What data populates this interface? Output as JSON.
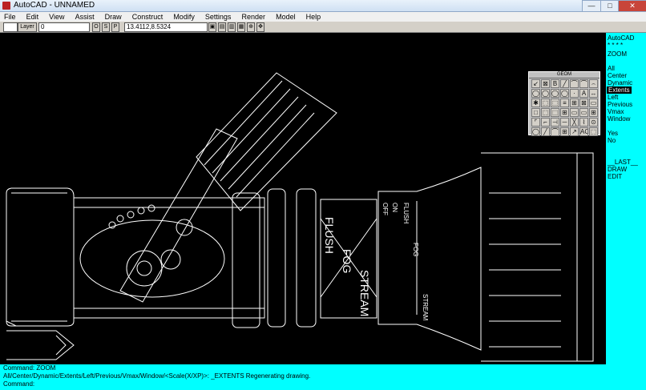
{
  "window": {
    "title": "AutoCAD - UNNAMED",
    "min": "—",
    "max": "□",
    "close": "✕"
  },
  "menu": [
    "File",
    "Edit",
    "View",
    "Assist",
    "Draw",
    "Construct",
    "Modify",
    "Settings",
    "Render",
    "Model",
    "Help"
  ],
  "toolbar": {
    "layer_label": "Layer",
    "layer_value": "0",
    "snap_o": "O",
    "snap_s": "S",
    "snap_p": "P",
    "coords": "13.4112,8.5324"
  },
  "side_menu": {
    "header": "AutoCAD",
    "stars": "* * * *",
    "items": [
      "ZOOM",
      "",
      "All",
      "Center",
      "Dynamic",
      "Extents",
      "Left",
      "Previous",
      "Vmax",
      "Window",
      "",
      "Yes",
      "No",
      "",
      "",
      "__LAST__",
      "DRAW",
      "EDIT"
    ]
  },
  "palette": {
    "title": "GEOM",
    "cells": [
      "↙",
      "⊠",
      "B",
      "╱",
      "⌒",
      "⌒",
      "⌢",
      "◯",
      "◯",
      "◯",
      "◯",
      "·",
      "A",
      "↔",
      "✱",
      "⬚",
      "⬚",
      "≡",
      "⊞",
      "⊠",
      "▭",
      "□",
      "⬚",
      "⬚",
      "⊞",
      "▭",
      "▭",
      "⊞",
      "⌜",
      "⌐",
      "⊣",
      "─",
      "╳",
      "⌇",
      "⊙",
      "◯",
      "╱",
      "⌒",
      "⊞",
      "↗",
      "AC",
      "⬚"
    ]
  },
  "drawing_text": {
    "flush": "FLUSH",
    "fog": "FOG",
    "stream": "STREAM",
    "off": "OFF",
    "on": "ON",
    "flush_r": "FLUSH",
    "fog_r": "FOG",
    "stream_r": "STREAM"
  },
  "command": {
    "line1": "Command:  ZOOM",
    "line2": "All/Center/Dynamic/Extents/Left/Previous/Vmax/Window/<Scale(X/XP)>: _EXTENTS  Regenerating drawing.",
    "line3": "Command:"
  },
  "colors": {
    "canvas": "#000000",
    "sidebar": "#00ffff",
    "lines": "#ffffff"
  }
}
